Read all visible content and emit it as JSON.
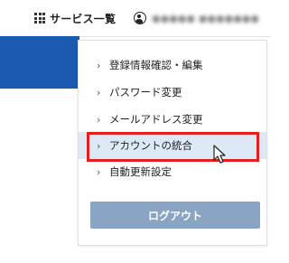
{
  "header": {
    "services_label": "サービス一覧",
    "services_icon": "grid-icon",
    "user_icon": "user-icon",
    "user_name": "●●●●● ●●●●●●●"
  },
  "menu": {
    "items": [
      {
        "label": "登録情報確認・編集",
        "icon": "chevron-right-icon"
      },
      {
        "label": "パスワード変更",
        "icon": "chevron-right-icon"
      },
      {
        "label": "メールアドレス変更",
        "icon": "chevron-right-icon"
      },
      {
        "label": "アカウントの統合",
        "icon": "chevron-right-icon",
        "state": "hover"
      },
      {
        "label": "自動更新設定",
        "icon": "chevron-right-icon"
      }
    ],
    "logout_label": "ログアウト"
  },
  "colors": {
    "banner": "#1a5ab0",
    "hover_bg": "#dde9f6",
    "highlight_border": "#e51f1f",
    "logout_bg": "#8aa5c3"
  }
}
